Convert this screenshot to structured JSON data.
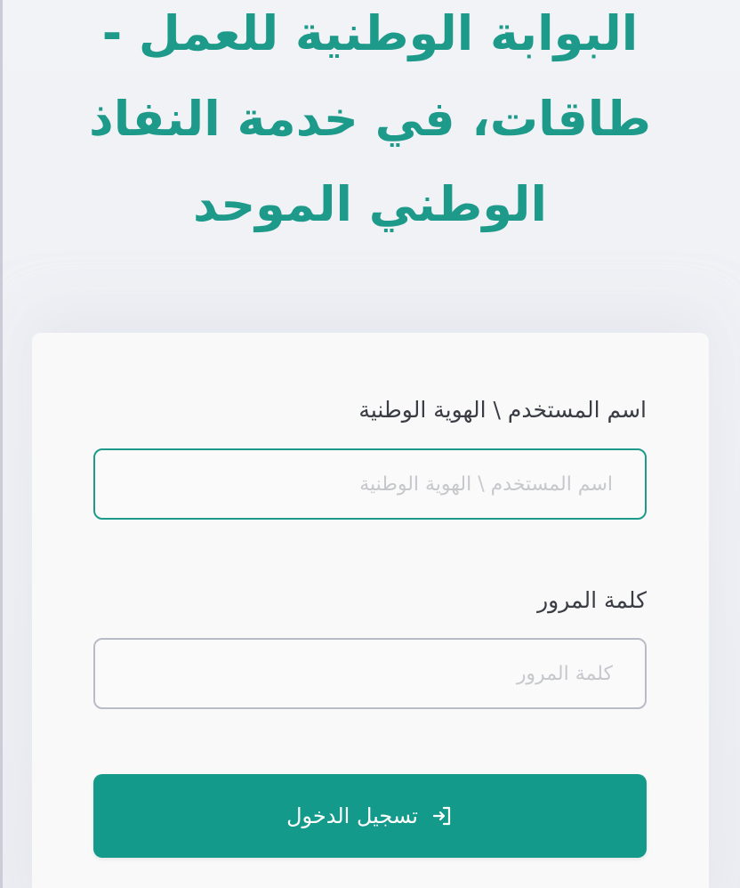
{
  "header": {
    "line1": "البوابة الوطنية للعمل -",
    "line2": "طاقات، في خدمة النفاذ",
    "line3": "الوطني الموحد"
  },
  "login_form": {
    "username": {
      "label": "اسم المستخدم \\ الهوية الوطنية",
      "placeholder": "اسم المستخدم \\ الهوية الوطنية",
      "value": ""
    },
    "password": {
      "label": "كلمة المرور",
      "placeholder": "كلمة المرور",
      "value": ""
    },
    "submit": {
      "label": "تسجيل الدخول",
      "icon": "sign-in-icon"
    }
  },
  "colors": {
    "brand": "#1d9a8a",
    "button": "#149a8b",
    "active_border": "#1d9a8a",
    "inactive_border": "#b9bcc6"
  }
}
